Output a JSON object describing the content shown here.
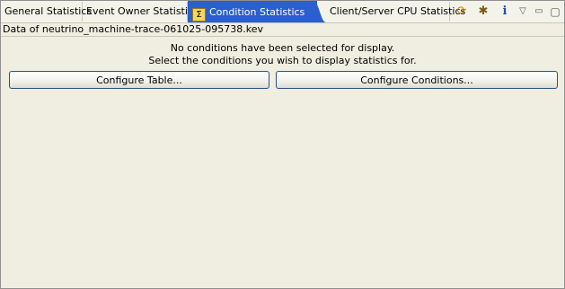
{
  "tabs": [
    {
      "label": "General Statistics"
    },
    {
      "label": "Event Owner Statistics"
    },
    {
      "label": "Condition Statistics",
      "active": true,
      "icon": "sigma-icon",
      "close_glyph": "✕"
    },
    {
      "label": "Client/Server CPU Statistics"
    }
  ],
  "toolbar": {
    "sync_icon": "⟳",
    "bug_icon": "✱",
    "info_icon": "i",
    "menu_icon": "▽",
    "minimize_icon": "▭",
    "maximize_icon": "▢"
  },
  "header": {
    "data_title": "Data of neutrino_machine-trace-061025-095738.kev"
  },
  "main": {
    "message_line1": "No conditions have been selected for display.",
    "message_line2": "Select the conditions you wish to display statistics for.",
    "configure_table_label": "Configure Table...",
    "configure_conditions_label": "Configure Conditions..."
  },
  "colors": {
    "active_tab": "#2b5fd0",
    "panel_bg": "#efeee0"
  }
}
